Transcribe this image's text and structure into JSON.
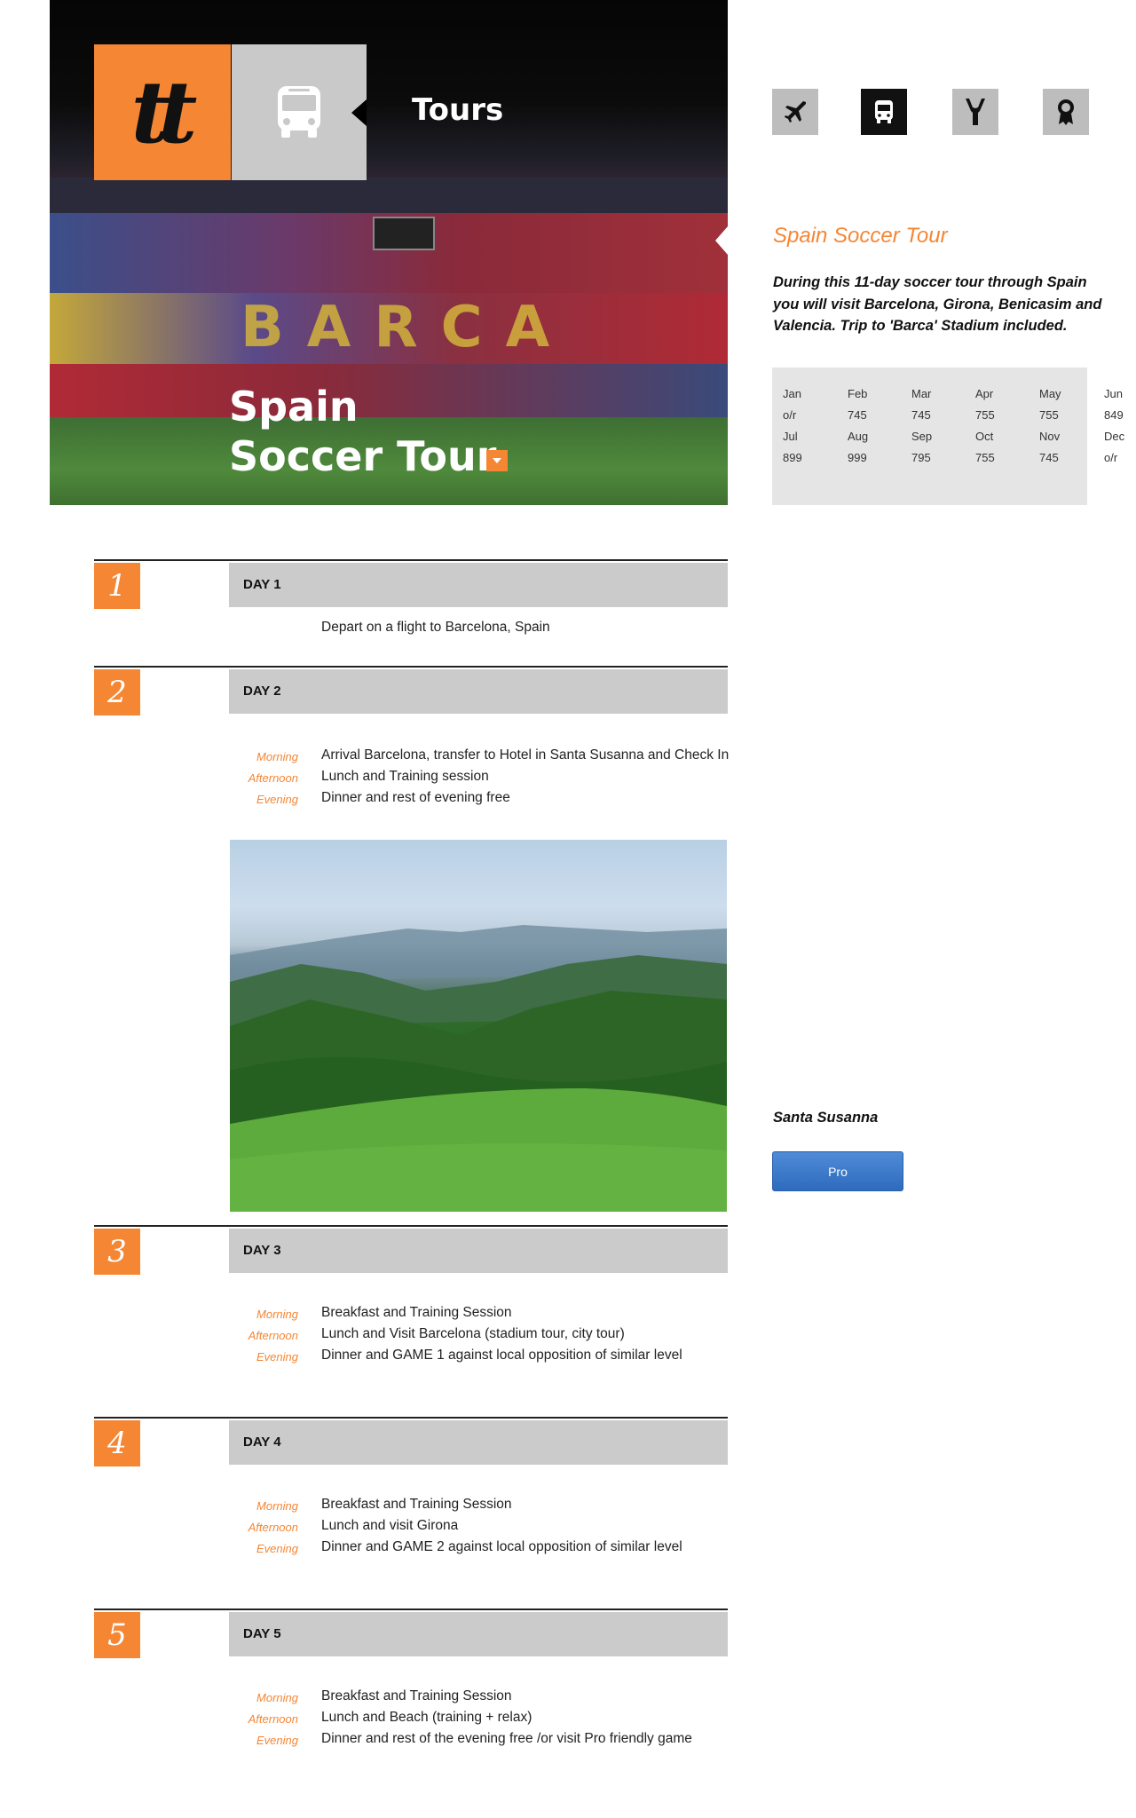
{
  "hero": {
    "logo_text": "tt",
    "section_title": "Tours",
    "title_line1": "Spain",
    "title_line2": "Soccer Tour",
    "stadium_letters": "BARCA"
  },
  "categories": [
    {
      "icon": "plane-icon",
      "active": false
    },
    {
      "icon": "bus-icon",
      "active": true
    },
    {
      "icon": "trophy-icon",
      "active": false
    },
    {
      "icon": "award-ribbon-icon",
      "active": false
    }
  ],
  "sidebar": {
    "title": "Spain Soccer Tour",
    "description": "During this 11-day soccer tour through Spain you will visit Barcelona, Girona, Benicasim and Valencia. Trip to 'Barca' Stadium included.",
    "prices": {
      "row1_months": [
        "Jan",
        "Feb",
        "Mar",
        "Apr",
        "May",
        "Jun"
      ],
      "row1_prices": [
        "o/r",
        "745",
        "745",
        "755",
        "755",
        "849"
      ],
      "row2_months": [
        "Jul",
        "Aug",
        "Sep",
        "Oct",
        "Nov",
        "Dec"
      ],
      "row2_prices": [
        "899",
        "999",
        "795",
        "755",
        "745",
        "o/r"
      ]
    },
    "image_caption": "Santa Susanna",
    "button_label": "Pro"
  },
  "days": [
    {
      "number": "1",
      "label": "DAY 1",
      "note": "Depart on a flight to Barcelona, Spain"
    },
    {
      "number": "2",
      "label": "DAY 2",
      "morning_label": "Morning",
      "morning": "Arrival Barcelona, transfer to Hotel in Santa Susanna and Check In",
      "afternoon_label": "Afternoon",
      "afternoon": "Lunch and Training session",
      "evening_label": "Evening",
      "evening": "Dinner and rest of evening free"
    },
    {
      "number": "3",
      "label": "DAY 3",
      "morning_label": "Morning",
      "morning": "Breakfast and Training Session",
      "afternoon_label": "Afternoon",
      "afternoon": "Lunch and Visit Barcelona (stadium tour, city tour)",
      "evening_label": "Evening",
      "evening": "Dinner and GAME 1 against local opposition of similar level"
    },
    {
      "number": "4",
      "label": "DAY 4",
      "morning_label": "Morning",
      "morning": "Breakfast and Training Session",
      "afternoon_label": "Afternoon",
      "afternoon": "Lunch and visit Girona",
      "evening_label": "Evening",
      "evening": "Dinner and GAME 2 against local opposition of similar level"
    },
    {
      "number": "5",
      "label": "DAY 5",
      "morning_label": "Morning",
      "morning": "Breakfast and Training Session",
      "afternoon_label": "Afternoon",
      "afternoon": "Lunch  and Beach (training + relax)",
      "evening_label": "Evening",
      "evening": "Dinner and rest of the evening free /or visit Pro friendly game"
    }
  ],
  "colors": {
    "accent": "#f58634",
    "tile_gray": "#c9c9c9",
    "bar_gray": "#cbcbcb",
    "button_blue": "#3a78c9"
  }
}
